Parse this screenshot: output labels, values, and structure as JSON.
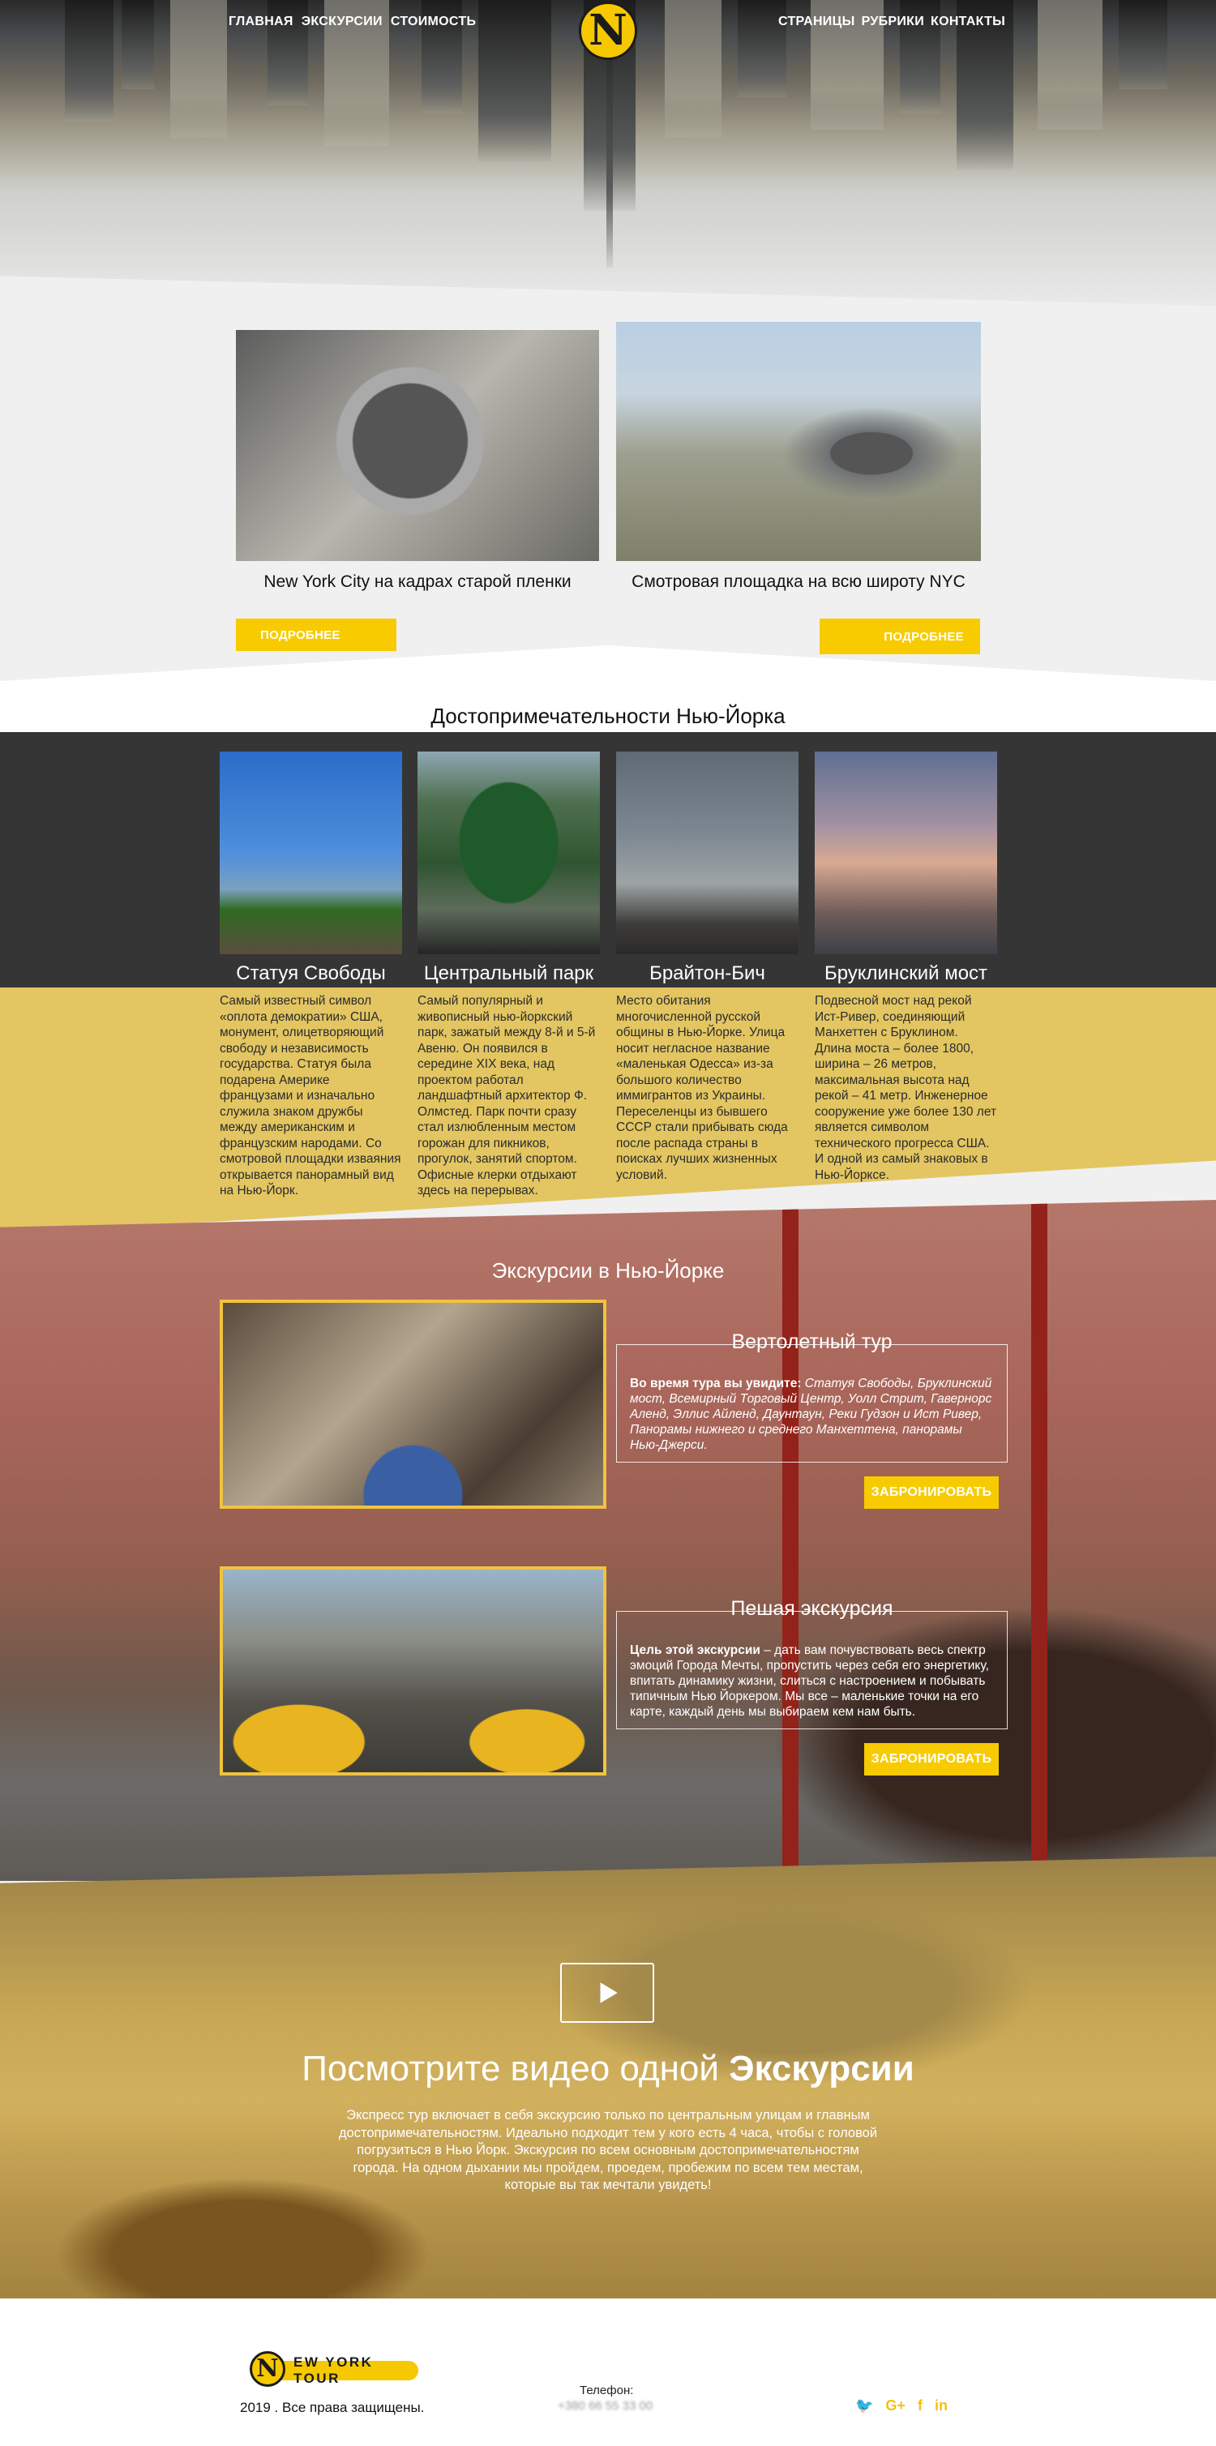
{
  "nav": {
    "left": [
      "ГЛАВНАЯ",
      "ЭКСКУРСИИ",
      "СТОИМОСТЬ"
    ],
    "right": [
      "СТРАНИЦЫ",
      "РУБРИКИ",
      "КОНТАКТЫ"
    ],
    "logo_letter": "N"
  },
  "cards": [
    {
      "caption": "New York City на кадрах  старой пленки",
      "button": "ПОДРОБНЕЕ"
    },
    {
      "caption": "Смотровая площадка на всю широту NYC",
      "button": "ПОДРОБНЕЕ"
    }
  ],
  "sights": {
    "title": "Достопримечательности Нью-Йорка",
    "items": [
      {
        "title": "Статуя Свободы",
        "desc": "Самый известный символ «оплота демократии» США, монумент, олицетворяющий свободу и независимость государства. Статуя была подарена Америке французами и изначально служила знаком дружбы между американским и французским народами. Со смотровой площадки изваяния открывается панорамный вид на Нью-Йорк."
      },
      {
        "title": "Центральный парк",
        "desc": "Самый популярный и живописный нью-йоркский парк, зажатый между 8-й и 5-й Авеню. Он появился в середине XIX века, над проектом работал ландшафтный архитектор Ф. Олмстед. Парк почти сразу стал излюбленным местом горожан для пикников, прогулок, занятий спортом. Офисные клерки отдыхают здесь на перерывах."
      },
      {
        "title": "Брайтон-Бич",
        "desc": "Место обитания многочисленной русской общины в Нью-Йорке. Улица носит негласное название «маленькая Одесса» из-за большого количество иммигрантов из Украины. Переселенцы из бывшего СССР стали прибывать сюда после распада страны в поисках лучших жизненных условий."
      },
      {
        "title": "Бруклинский мост",
        "desc": "Подвесной мост над рекой Ист-Ривер, соединяющий Манхеттен с Бруклином. Длина моста – более 1800, ширина – 26 метров, максимальная высота над рекой – 41 метр. Инженерное сооружение уже более 130 лет является символом технического прогресса США. И одной из самый знаковых в Нью-Йорксе."
      }
    ]
  },
  "excursions": {
    "title": "Экскурсии в Нью-Йорке",
    "items": [
      {
        "title": "Вертолетный тур",
        "lead": "Во время тура вы увидите:",
        "text": "Статуя Свободы, Бруклинский мост, Всемирный Торговый Центр, Уолл Стрит, Гавернорс Аленд, Эллис Айленд, Даунтаун, Реки Гудзон и Ист Ривер, Панорамы нижнего и среднего Манхеттена, панорамы Нью-Джерси.",
        "button": "ЗАБРОНИРОВАТЬ"
      },
      {
        "title": "Пешая экскурсия",
        "lead": "Цель этой экскурсии",
        "text": " – дать вам почувствовать весь спектр эмоций Города Мечты, пропустить через себя его энергетику, впитать динамику жизни, слиться с настроением и побывать типичным Нью Йоркером. Мы все – маленькие точки на его карте, каждый день мы выбираем кем нам быть.",
        "button": "ЗАБРОНИРОВАТЬ"
      }
    ]
  },
  "video": {
    "title_normal": "Посмотрите видео одной ",
    "title_bold": "Экскурсии",
    "desc": "Экспресс тур включает в себя экскурсию только по центральным улицам и главным достопримечательностям. Идеально подходит тем у кого есть 4 часа, чтобы с головой погрузиться в Нью Йорк. Экскурсия по всем основным достопримечательностям города. На одном дыхании мы пройдем, проедем, пробежим по всем тем местам, которые вы так мечтали увидеть!"
  },
  "footer": {
    "logo_letter": "N",
    "logo_text": "EW YORK TOUR",
    "copyright": "2019 . Все права защищены.",
    "phone_label": "Телефон:",
    "phone": "+380 66 55 33 00",
    "social": [
      "twitter-icon",
      "google-plus-icon",
      "facebook-icon",
      "linkedin-icon"
    ],
    "social_glyphs": [
      "🐦",
      "G+",
      "f",
      "in"
    ]
  },
  "colors": {
    "accent": "#f8cb00",
    "dark": "#353535",
    "sand": "#e3c662"
  }
}
